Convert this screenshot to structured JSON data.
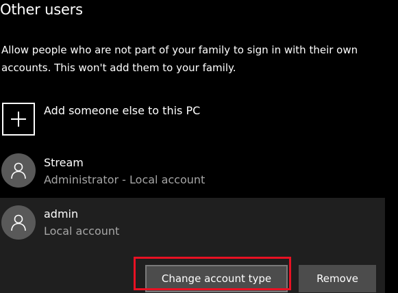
{
  "section": {
    "title": "Other users",
    "description": "Allow people who are not part of your family to sign in with their own accounts. This won't add them to your family."
  },
  "add_user": {
    "label": "Add someone else to this PC",
    "icon": "plus-icon"
  },
  "users": [
    {
      "name": "Stream",
      "account_type": "Administrator - Local account",
      "icon": "person-icon"
    },
    {
      "name": "admin",
      "account_type": "Local account",
      "icon": "person-icon",
      "selected": true
    }
  ],
  "actions": {
    "change_account_type_label": "Change account type",
    "remove_label": "Remove"
  },
  "colors": {
    "background": "#000000",
    "selected_row": "#1f1f1f",
    "avatar": "#595959",
    "button": "#4c4c4c",
    "secondary_text": "#a6a6a6",
    "highlight": "#e81123"
  }
}
